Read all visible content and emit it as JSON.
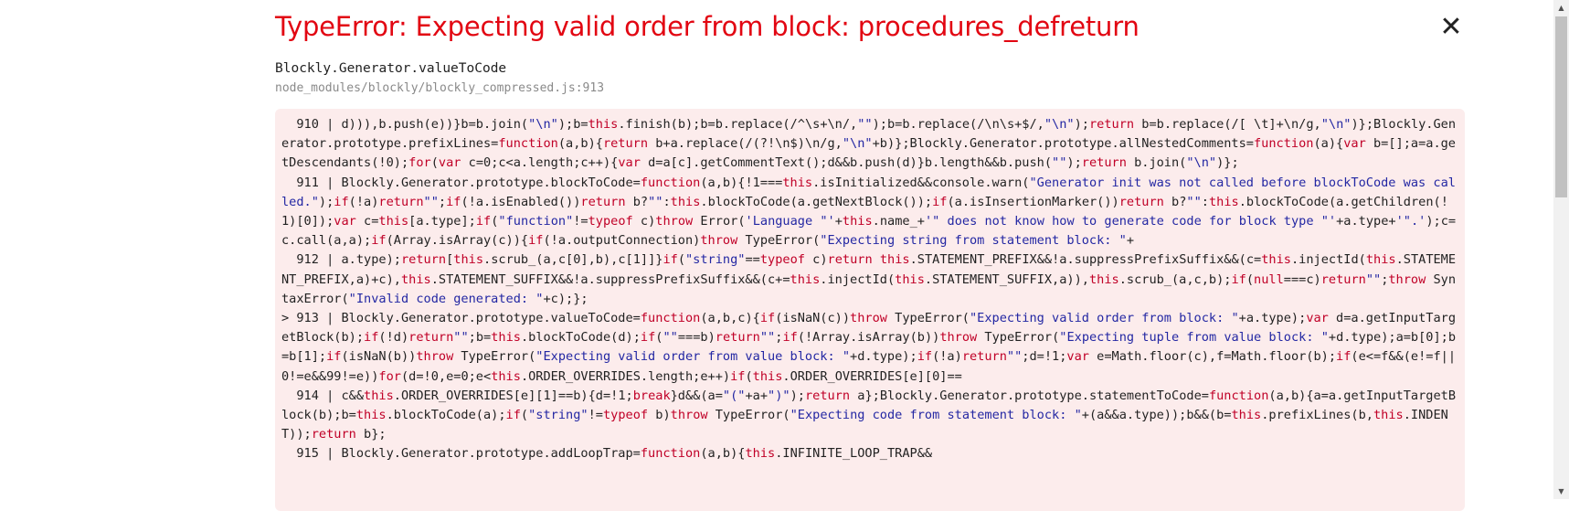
{
  "error": {
    "title": "TypeError: Expecting valid order from block: procedures_defreturn",
    "close_glyph": "✕"
  },
  "stack_frame": {
    "function": "Blockly.Generator.valueToCode",
    "file": "node_modules/blockly/blockly_compressed.js:913"
  },
  "code_lines": [
    {
      "prefix": "  910 | ",
      "code": "d))),b.push(e))}b=b.join(\"\\n\");b=this.finish(b);b=b.replace(/^\\s+\\n/,\"\");b=b.replace(/\\n\\s+$/,\"\\n\");return b=b.replace(/[ \\t]+\\n/g,\"\\n\")};Blockly.Generator.prototype.prefixLines=function(a,b){return b+a.replace(/(?!\\n$)\\n/g,\"\\n\"+b)};Blockly.Generator.prototype.allNestedComments=function(a){var b=[];a=a.getDescendants(!0);for(var c=0;c<a.length;c++){var d=a[c].getCommentText();d&&b.push(d)}b.length&&b.push(\"\");return b.join(\"\\n\")};"
    },
    {
      "prefix": "  911 | ",
      "code": "Blockly.Generator.prototype.blockToCode=function(a,b){!1===this.isInitialized&&console.warn(\"Generator init was not called before blockToCode was called.\");if(!a)return\"\";if(!a.isEnabled())return b?\"\":this.blockToCode(a.getNextBlock());if(a.isInsertionMarker())return b?\"\":this.blockToCode(a.getChildren(!1)[0]);var c=this[a.type];if(\"function\"!=typeof c)throw Error('Language \"'+this.name_+'\" does not know how to generate code for block type \"'+a.type+'\".');c=c.call(a,a);if(Array.isArray(c)){if(!a.outputConnection)throw TypeError(\"Expecting string from statement block: \"+"
    },
    {
      "prefix": "  912 | ",
      "code": "a.type);return[this.scrub_(a,c[0],b),c[1]]}if(\"string\"==typeof c)return this.STATEMENT_PREFIX&&!a.suppressPrefixSuffix&&(c=this.injectId(this.STATEMENT_PREFIX,a)+c),this.STATEMENT_SUFFIX&&!a.suppressPrefixSuffix&&(c+=this.injectId(this.STATEMENT_SUFFIX,a)),this.scrub_(a,c,b);if(null===c)return\"\";throw SyntaxError(\"Invalid code generated: \"+c);};"
    },
    {
      "prefix": "> 913 | ",
      "code": "Blockly.Generator.prototype.valueToCode=function(a,b,c){if(isNaN(c))throw TypeError(\"Expecting valid order from block: \"+a.type);var d=a.getInputTargetBlock(b);if(!d)return\"\";b=this.blockToCode(d);if(\"\"===b)return\"\";if(!Array.isArray(b))throw TypeError(\"Expecting tuple from value block: \"+d.type);a=b[0];b=b[1];if(isNaN(b))throw TypeError(\"Expecting valid order from value block: \"+d.type);if(!a)return\"\";d=!1;var e=Math.floor(c),f=Math.floor(b);if(e<=f&&(e!=f||0!=e&&99!=e))for(d=!0,e=0;e<this.ORDER_OVERRIDES.length;e++)if(this.ORDER_OVERRIDES[e][0]=="
    },
    {
      "prefix": "  914 | ",
      "code": "c&&this.ORDER_OVERRIDES[e][1]==b){d=!1;break}d&&(a=\"(\"+a+\")\");return a};Blockly.Generator.prototype.statementToCode=function(a,b){a=a.getInputTargetBlock(b);b=this.blockToCode(a);if(\"string\"!=typeof b)throw TypeError(\"Expecting code from statement block: \"+(a&&a.type));b&&(b=this.prefixLines(b,this.INDENT));return b};"
    },
    {
      "prefix": "  915 | ",
      "code": "Blockly.Generator.prototype.addLoopTrap=function(a,b){this.INFINITE_LOOP_TRAP&&"
    }
  ],
  "scrollbar": {
    "up_arrow": "▲",
    "down_arrow": "▼"
  }
}
